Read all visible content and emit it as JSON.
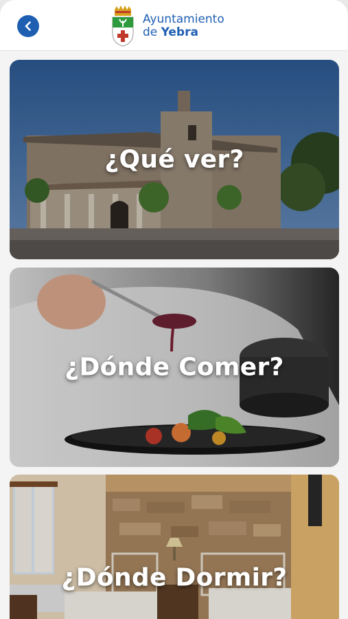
{
  "header": {
    "back_icon": "chevron-left-icon",
    "logo_icon": "coat-of-arms-icon",
    "logo_line1": "Ayuntamiento",
    "logo_line2_prefix": "de ",
    "logo_line2_bold": "Yebra",
    "brand_color": "#1e5fb2"
  },
  "cards": [
    {
      "title": "¿Qué ver?",
      "image": "church-photo"
    },
    {
      "title": "¿Dónde Comer?",
      "image": "chef-plating-photo"
    },
    {
      "title": "¿Dónde Dormir?",
      "image": "hotel-room-photo"
    }
  ]
}
